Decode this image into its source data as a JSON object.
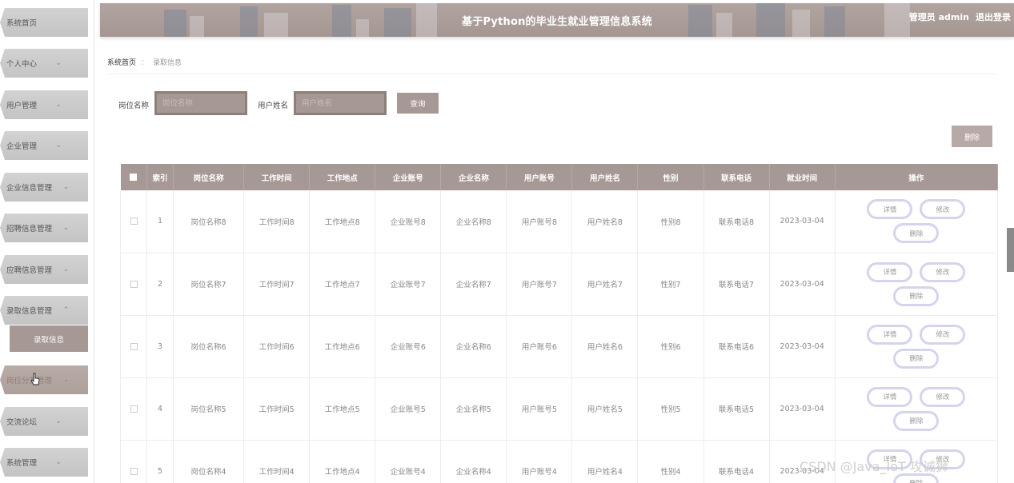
{
  "sidebar": {
    "items": [
      {
        "label": "系统首页",
        "chevron": ""
      },
      {
        "label": "个人中心",
        "chevron": "⌄"
      },
      {
        "label": "用户管理",
        "chevron": "⌄"
      },
      {
        "label": "企业管理",
        "chevron": "⌄"
      },
      {
        "label": "企业信息管理",
        "chevron": "⌄"
      },
      {
        "label": "招聘信息管理",
        "chevron": "⌄"
      },
      {
        "label": "应聘信息管理",
        "chevron": "⌄"
      },
      {
        "label": "录取信息管理",
        "chevron": "⌃"
      },
      {
        "label": "岗位分类管理",
        "chevron": "⌄"
      },
      {
        "label": "交流论坛",
        "chevron": "⌄"
      },
      {
        "label": "系统管理",
        "chevron": "⌄"
      }
    ],
    "submenu_label": "录取信息"
  },
  "header": {
    "title": "基于Python的毕业生就业管理信息系统",
    "user": "管理员 admin",
    "logout": "退出登录"
  },
  "breadcrumb": {
    "home": "系统首页",
    "separator": "：",
    "current": "录取信息"
  },
  "search": {
    "label1": "岗位名称",
    "placeholder1": "岗位名称",
    "label2": "用户姓名",
    "placeholder2": "用户姓名",
    "button": "查询"
  },
  "toolbar": {
    "delete": "删除"
  },
  "table": {
    "headers": [
      "",
      "索引",
      "岗位名称",
      "工作时间",
      "工作地点",
      "企业账号",
      "企业名称",
      "用户账号",
      "用户姓名",
      "性别",
      "联系电话",
      "就业时间",
      "操作"
    ],
    "rows": [
      [
        "1",
        "岗位名称8",
        "工作时间8",
        "工作地点8",
        "企业账号8",
        "企业名称8",
        "用户账号8",
        "用户姓名8",
        "性别8",
        "联系电话8",
        "2023-03-04"
      ],
      [
        "2",
        "岗位名称7",
        "工作时间7",
        "工作地点7",
        "企业账号7",
        "企业名称7",
        "用户账号7",
        "用户姓名7",
        "性别7",
        "联系电话7",
        "2023-03-04"
      ],
      [
        "3",
        "岗位名称6",
        "工作时间6",
        "工作地点6",
        "企业账号6",
        "企业名称6",
        "用户账号6",
        "用户姓名6",
        "性别6",
        "联系电话6",
        "2023-03-04"
      ],
      [
        "4",
        "岗位名称5",
        "工作时间5",
        "工作地点5",
        "企业账号5",
        "企业名称5",
        "用户账号5",
        "用户姓名5",
        "性别5",
        "联系电话5",
        "2023-03-04"
      ],
      [
        "5",
        "岗位名称4",
        "工作时间4",
        "工作地点4",
        "企业账号4",
        "企业名称4",
        "用户账号4",
        "用户姓名4",
        "性别4",
        "联系电话4",
        "2023-03-04"
      ]
    ],
    "ops": {
      "detail": "详情",
      "edit": "修改",
      "delete": "删除"
    }
  },
  "watermark": "CSDN @Java_IoT 攻诚狮",
  "colors": {
    "accent": "#a69894",
    "header": "#ab9d98",
    "op_border": "#d4d4ec"
  }
}
